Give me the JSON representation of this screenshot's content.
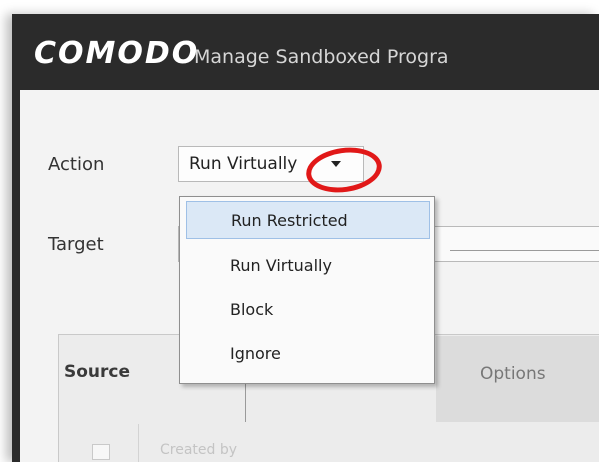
{
  "window": {
    "brand": "COMODO",
    "title": "Manage Sandboxed Progra"
  },
  "form": {
    "action_label": "Action",
    "action_value": "Run Virtually",
    "target_label": "Target"
  },
  "dropdown": {
    "items": [
      "Run Restricted",
      "Run Virtually",
      "Block",
      "Ignore"
    ],
    "highlighted": "Run Restricted"
  },
  "tabs": {
    "source_label": "Source",
    "options_label": "Options"
  },
  "table": {
    "row_text": "Created by"
  },
  "colors": {
    "callout": "#e11818",
    "highlight": "#dbe8f6"
  }
}
